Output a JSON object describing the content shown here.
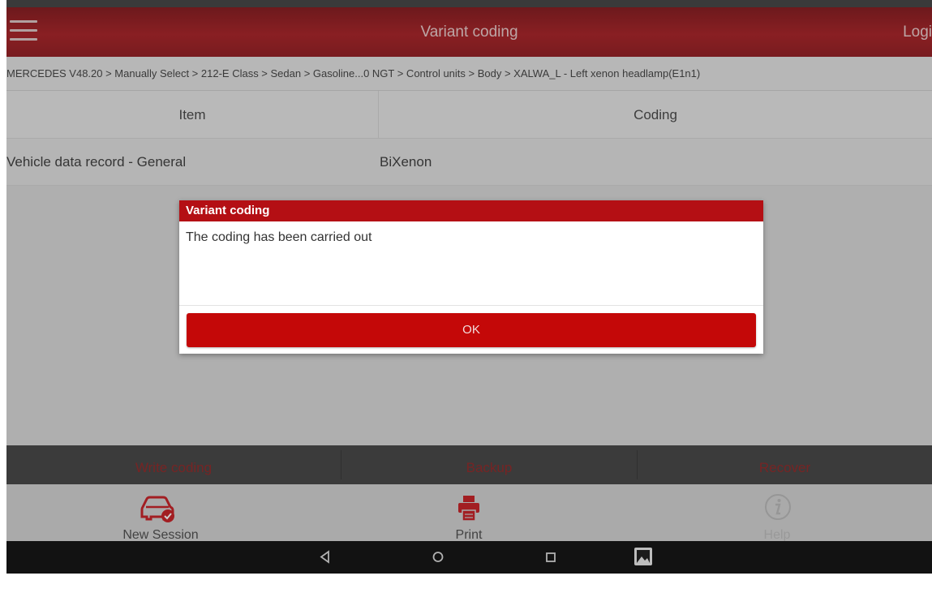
{
  "app": {
    "title": "Variant coding",
    "login_label": "Logi"
  },
  "breadcrumb": "MERCEDES V48.20 > Manually Select > 212-E Class > Sedan > Gasoline...0 NGT > Control units > Body > XALWA_L - Left xenon headlamp(E1n1)",
  "table": {
    "headers": [
      "Item",
      "Coding"
    ],
    "rows": [
      {
        "item": "Vehicle data record - General",
        "coding": "BiXenon"
      }
    ]
  },
  "actions": {
    "write": "Write coding",
    "backup": "Backup",
    "recover": "Recover"
  },
  "bottom_nav": {
    "new_session": "New Session",
    "print": "Print",
    "help": "Help"
  },
  "dialog": {
    "title": "Variant coding",
    "message": "The coding has been carried out",
    "ok_label": "OK"
  },
  "icons": {
    "menu": "hamburger-icon",
    "new_session": "car-icon",
    "print": "printer-icon",
    "help": "info-circle-icon",
    "back": "back-triangle-icon",
    "home": "home-circle-icon",
    "recents": "recents-square-icon",
    "gallery": "image-icon"
  },
  "colors": {
    "accent": "#b40f14",
    "button_red": "#c40808",
    "appbar": "#9a1419"
  }
}
